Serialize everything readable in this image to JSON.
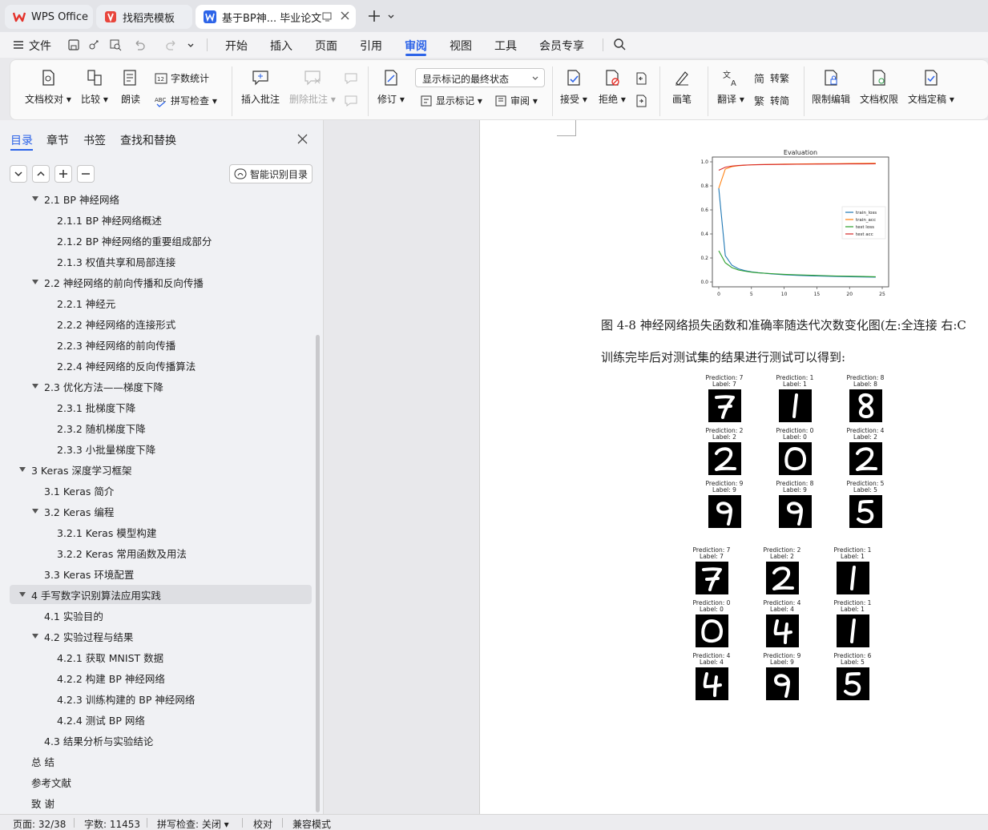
{
  "tabs": [
    {
      "label": "WPS Office",
      "icon": "wps-logo-icon"
    },
    {
      "label": "找稻壳模板",
      "icon": "docer-logo-icon"
    },
    {
      "label": "基于BP神... 毕业论文",
      "icon": "word-doc-icon"
    }
  ],
  "menu": {
    "file": "文件",
    "items": [
      "开始",
      "插入",
      "页面",
      "引用",
      "审阅",
      "视图",
      "工具",
      "会员专享"
    ],
    "active": "审阅"
  },
  "ribbon": {
    "proofread": "文档校对",
    "compare": "比较",
    "read_aloud": "朗读",
    "word_count": "字数统计",
    "spell_check": "拼写检查",
    "insert_comment": "插入批注",
    "delete_comment": "删除批注",
    "track_changes": "修订",
    "markup_state": "显示标记的最终状态",
    "show_markup": "显示标记",
    "review_pane": "审阅",
    "accept": "接受",
    "reject": "拒绝",
    "pen": "画笔",
    "translate": "翻译",
    "to_traditional": "转繁",
    "to_simplified": "转简",
    "restrict_edit": "限制编辑",
    "doc_permission": "文档权限",
    "finalize": "文档定稿"
  },
  "nav": {
    "tabs": [
      "目录",
      "章节",
      "书签",
      "查找和替换"
    ],
    "smart_toc": "智能识别目录",
    "toc": [
      {
        "text": "2.1 BP 神经网络",
        "level": 2,
        "caret": true
      },
      {
        "text": "2.1.1 BP 神经网络概述",
        "level": 3
      },
      {
        "text": "2.1.2 BP 神经网络的重要组成部分",
        "level": 3
      },
      {
        "text": "2.1.3  权值共享和局部连接",
        "level": 3
      },
      {
        "text": "2.2  神经网络的前向传播和反向传播",
        "level": 2,
        "caret": true
      },
      {
        "text": "2.2.1  神经元",
        "level": 3
      },
      {
        "text": "2.2.2  神经网络的连接形式",
        "level": 3
      },
      {
        "text": "2.2.3  神经网络的前向传播",
        "level": 3
      },
      {
        "text": "2.2.4  神经网络的反向传播算法",
        "level": 3
      },
      {
        "text": "2.3  优化方法——梯度下降",
        "level": 2,
        "caret": true
      },
      {
        "text": "2.3.1  批梯度下降",
        "level": 3
      },
      {
        "text": "2.3.2  随机梯度下降",
        "level": 3
      },
      {
        "text": "2.3.3  小批量梯度下降",
        "level": 3
      },
      {
        "text": "3 Keras 深度学习框架",
        "level": 1,
        "caret": true
      },
      {
        "text": "3.1 Keras 简介",
        "level": 2
      },
      {
        "text": "3.2 Keras 编程",
        "level": 2,
        "caret": true
      },
      {
        "text": "3.2.1 Keras 模型构建",
        "level": 3
      },
      {
        "text": "3.2.2 Keras 常用函数及用法",
        "level": 3
      },
      {
        "text": "3.3 Keras 环境配置",
        "level": 2
      },
      {
        "text": "4  手写数字识别算法应用实践",
        "level": 1,
        "caret": true,
        "selected": true
      },
      {
        "text": "4.1 实验目的",
        "level": 2
      },
      {
        "text": "4.2 实验过程与结果",
        "level": 2,
        "caret": true
      },
      {
        "text": "4.2.1 获取 MNIST 数据",
        "level": 3
      },
      {
        "text": "4.2.2 构建 BP 神经网络",
        "level": 3
      },
      {
        "text": "4.2.3 训练构建的 BP 神经网络",
        "level": 3
      },
      {
        "text": "4.2.4 测试 BP 网络",
        "level": 3
      },
      {
        "text": "4.3 结果分析与实验结论",
        "level": 2
      },
      {
        "text": "总   结",
        "level": 1
      },
      {
        "text": "参考文献",
        "level": 1
      },
      {
        "text": "致   谢",
        "level": 1
      }
    ]
  },
  "document": {
    "figure_caption": "图 4-8  神经网络损失函数和准确率随迭代次数变化图(左:全连接  右:C",
    "body_text": "训练完毕后对测试集的结果进行测试可以得到:",
    "grid1": [
      {
        "pred": "Prediction: 7",
        "label": "Label: 7",
        "digit": "7"
      },
      {
        "pred": "Prediction: 1",
        "label": "Label: 1",
        "digit": "1"
      },
      {
        "pred": "Prediction: 8",
        "label": "Label: 8",
        "digit": "8"
      },
      {
        "pred": "Prediction: 2",
        "label": "Label: 2",
        "digit": "2"
      },
      {
        "pred": "Prediction: 0",
        "label": "Label: 0",
        "digit": "0"
      },
      {
        "pred": "Prediction: 4",
        "label": "Label: 2",
        "digit": "2"
      },
      {
        "pred": "Prediction: 9",
        "label": "Label: 9",
        "digit": "9"
      },
      {
        "pred": "Prediction: 8",
        "label": "Label: 9",
        "digit": "9"
      },
      {
        "pred": "Prediction: 5",
        "label": "Label: 5",
        "digit": "5"
      }
    ],
    "grid2": [
      {
        "pred": "Prediction: 7",
        "label": "Label: 7",
        "digit": "7"
      },
      {
        "pred": "Prediction: 2",
        "label": "Label: 2",
        "digit": "2"
      },
      {
        "pred": "Prediction: 1",
        "label": "Label: 1",
        "digit": "1"
      },
      {
        "pred": "Prediction: 0",
        "label": "Label: 0",
        "digit": "0"
      },
      {
        "pred": "Prediction: 4",
        "label": "Label: 4",
        "digit": "4"
      },
      {
        "pred": "Prediction: 1",
        "label": "Label: 1",
        "digit": "1"
      },
      {
        "pred": "Prediction: 4",
        "label": "Label: 4",
        "digit": "4"
      },
      {
        "pred": "Prediction: 9",
        "label": "Label: 9",
        "digit": "9"
      },
      {
        "pred": "Prediction: 6",
        "label": "Label: 5",
        "digit": "5"
      }
    ]
  },
  "chart_data": {
    "type": "line",
    "title": "Evaluation",
    "xlim": [
      0,
      25
    ],
    "ylim": [
      0.0,
      1.0
    ],
    "xticks": [
      "0",
      "5",
      "10",
      "15",
      "20",
      "25"
    ],
    "yticks": [
      "0.0",
      "0.2",
      "0.4",
      "0.6",
      "0.8",
      "1.0"
    ],
    "legend_position": "center-right",
    "x": [
      0,
      1,
      2,
      3,
      4,
      5,
      6,
      8,
      10,
      12,
      15,
      18,
      20,
      22,
      24
    ],
    "series": [
      {
        "name": "train_loss",
        "color": "#1f77b4",
        "values": [
          0.78,
          0.22,
          0.14,
          0.11,
          0.095,
          0.085,
          0.078,
          0.068,
          0.06,
          0.055,
          0.05,
          0.046,
          0.044,
          0.042,
          0.04
        ]
      },
      {
        "name": "train_acc",
        "color": "#ff7f0e",
        "values": [
          0.78,
          0.94,
          0.96,
          0.968,
          0.972,
          0.975,
          0.977,
          0.979,
          0.981,
          0.982,
          0.984,
          0.985,
          0.986,
          0.987,
          0.988
        ]
      },
      {
        "name": "test loss",
        "color": "#2ca02c",
        "values": [
          0.26,
          0.16,
          0.12,
          0.1,
          0.09,
          0.082,
          0.076,
          0.07,
          0.064,
          0.06,
          0.055,
          0.05,
          0.048,
          0.046,
          0.044
        ]
      },
      {
        "name": "test acc",
        "color": "#d62728",
        "values": [
          0.93,
          0.955,
          0.965,
          0.97,
          0.973,
          0.975,
          0.976,
          0.978,
          0.979,
          0.98,
          0.981,
          0.982,
          0.983,
          0.983,
          0.984
        ]
      }
    ]
  },
  "status": {
    "page": "页面: 32/38",
    "words": "字数: 11453",
    "spell": "拼写检查: 关闭",
    "proof": "校对",
    "compat": "兼容模式"
  }
}
